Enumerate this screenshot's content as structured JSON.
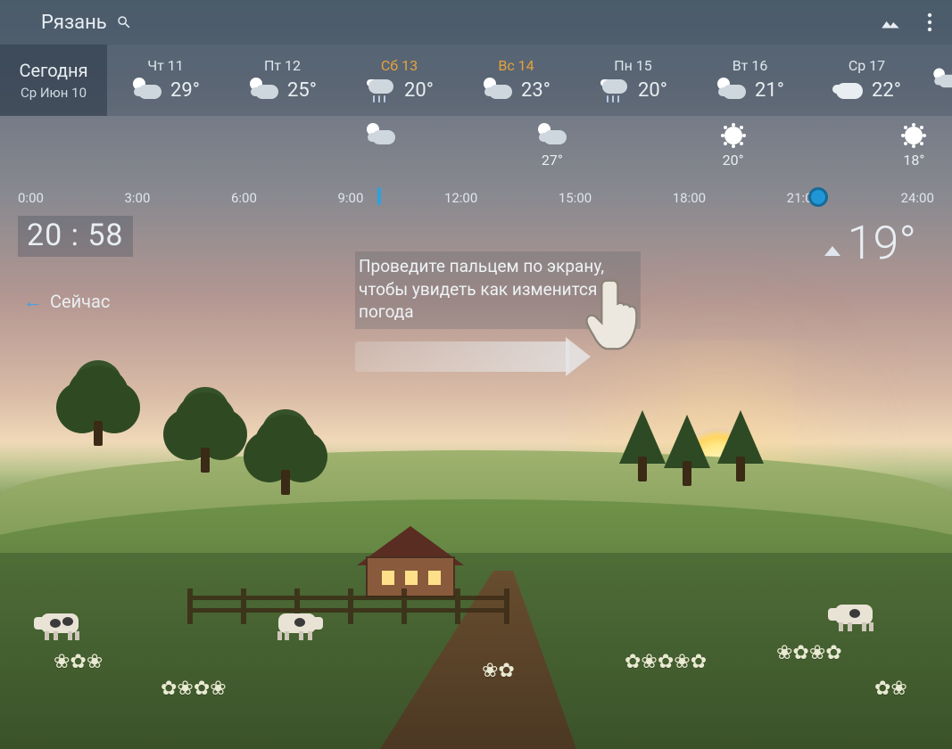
{
  "location": "Рязань",
  "today": {
    "label": "Сегодня",
    "date": "Ср Июн 10"
  },
  "forecast": [
    {
      "label": "Чт 11",
      "temp": "29°",
      "icon": "suncloud",
      "weekend": false
    },
    {
      "label": "Пт 12",
      "temp": "25°",
      "icon": "suncloud",
      "weekend": false
    },
    {
      "label": "Сб 13",
      "temp": "20°",
      "icon": "rain",
      "weekend": true
    },
    {
      "label": "Вс 14",
      "temp": "23°",
      "icon": "suncloud",
      "weekend": true
    },
    {
      "label": "Пн 15",
      "temp": "20°",
      "icon": "rain",
      "weekend": false
    },
    {
      "label": "Вт 16",
      "temp": "21°",
      "icon": "suncloud",
      "weekend": false
    },
    {
      "label": "Ср 17",
      "temp": "22°",
      "icon": "cloud",
      "weekend": false
    }
  ],
  "hourly_nodes": [
    {
      "pos": 0.4,
      "icon": "suncloud",
      "temp": ""
    },
    {
      "pos": 0.58,
      "icon": "suncloud",
      "temp": "27°"
    },
    {
      "pos": 0.77,
      "icon": "only-sun",
      "temp": "20°"
    },
    {
      "pos": 0.96,
      "icon": "only-sun",
      "temp": "18°"
    }
  ],
  "timeline_ticks": [
    "0:00",
    "3:00",
    "6:00",
    "9:00",
    "12:00",
    "15:00",
    "18:00",
    "21:00",
    "24:00"
  ],
  "clock": "20 : 58",
  "current_temp": "19°",
  "now_button": "Сейчас",
  "hint_text": "Проведите пальцем по экрану, чтобы увидеть как изменится погода"
}
